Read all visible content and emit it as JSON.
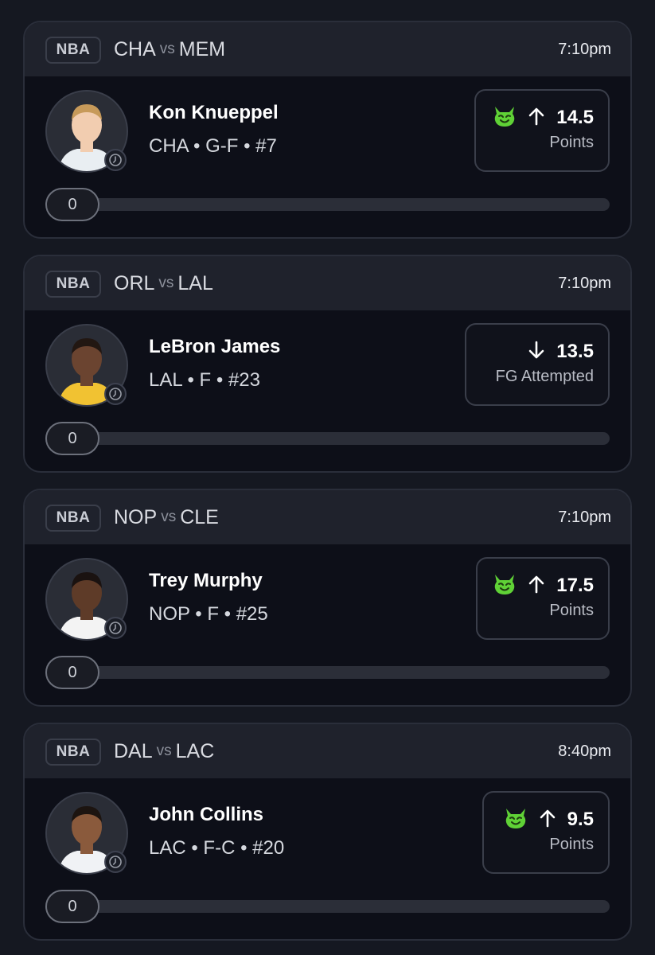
{
  "colors": {
    "background": "#151821",
    "card": "#0d0f18",
    "card_header": "#1f222c",
    "demon_icon": "#5fd136",
    "progress_track": "#2b2e38"
  },
  "cards": [
    {
      "league": "NBA",
      "team_a": "CHA",
      "vs": "vs",
      "team_b": "MEM",
      "time": "7:10pm",
      "player": {
        "name": "Kon Knueppel",
        "meta": "CHA • G-F • #7",
        "jersey_color": "#e9eef2",
        "skin": "#f2cdb0",
        "hair": "#c79a5a"
      },
      "pick": {
        "direction": "up",
        "value": "14.5",
        "stat": "Points",
        "demon": true
      },
      "progress": {
        "value": "0",
        "fraction": 0
      }
    },
    {
      "league": "NBA",
      "team_a": "ORL",
      "vs": "vs",
      "team_b": "LAL",
      "time": "7:10pm",
      "player": {
        "name": "LeBron James",
        "meta": "LAL • F • #23",
        "jersey_color": "#f1c232",
        "skin": "#6b4430",
        "hair": "#221712"
      },
      "pick": {
        "direction": "down",
        "value": "13.5",
        "stat": "FG Attempted",
        "demon": false
      },
      "progress": {
        "value": "0",
        "fraction": 0
      }
    },
    {
      "league": "NBA",
      "team_a": "NOP",
      "vs": "vs",
      "team_b": "CLE",
      "time": "7:10pm",
      "player": {
        "name": "Trey Murphy",
        "meta": "NOP • F • #25",
        "jersey_color": "#f3f3f3",
        "skin": "#5e3b28",
        "hair": "#1a1210"
      },
      "pick": {
        "direction": "up",
        "value": "17.5",
        "stat": "Points",
        "demon": true
      },
      "progress": {
        "value": "0",
        "fraction": 0
      }
    },
    {
      "league": "NBA",
      "team_a": "DAL",
      "vs": "vs",
      "team_b": "LAC",
      "time": "8:40pm",
      "player": {
        "name": "John Collins",
        "meta": "LAC • F-C • #20",
        "jersey_color": "#f0f2f5",
        "skin": "#8a5a3c",
        "hair": "#1c1410"
      },
      "pick": {
        "direction": "up",
        "value": "9.5",
        "stat": "Points",
        "demon": true
      },
      "progress": {
        "value": "0",
        "fraction": 0
      }
    }
  ]
}
